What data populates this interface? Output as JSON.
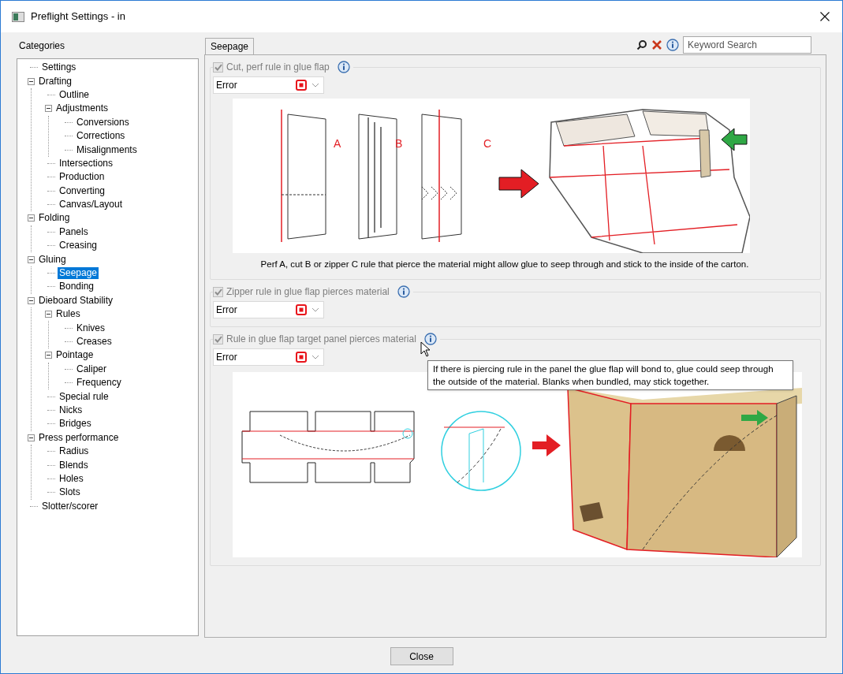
{
  "window": {
    "title": "Preflight Settings - in"
  },
  "categories": {
    "title": "Categories",
    "tree": [
      {
        "label": "Settings",
        "selected": false
      },
      {
        "label": "Drafting",
        "selected": false,
        "expanded": true,
        "children": [
          {
            "label": "Outline",
            "selected": false
          },
          {
            "label": "Adjustments",
            "selected": false,
            "expanded": true,
            "children": [
              {
                "label": "Conversions",
                "selected": false
              },
              {
                "label": "Corrections",
                "selected": false
              },
              {
                "label": "Misalignments",
                "selected": false
              }
            ]
          },
          {
            "label": "Intersections",
            "selected": false
          },
          {
            "label": "Production",
            "selected": false
          },
          {
            "label": "Converting",
            "selected": false
          },
          {
            "label": "Canvas/Layout",
            "selected": false
          }
        ]
      },
      {
        "label": "Folding",
        "selected": false,
        "expanded": true,
        "children": [
          {
            "label": "Panels",
            "selected": false
          },
          {
            "label": "Creasing",
            "selected": false
          }
        ]
      },
      {
        "label": "Gluing",
        "selected": false,
        "expanded": true,
        "children": [
          {
            "label": "Seepage",
            "selected": true
          },
          {
            "label": "Bonding",
            "selected": false
          }
        ]
      },
      {
        "label": "Dieboard Stability",
        "selected": false,
        "expanded": true,
        "children": [
          {
            "label": "Rules",
            "selected": false,
            "expanded": true,
            "children": [
              {
                "label": "Knives",
                "selected": false
              },
              {
                "label": "Creases",
                "selected": false
              }
            ]
          },
          {
            "label": "Pointage",
            "selected": false,
            "expanded": true,
            "children": [
              {
                "label": "Caliper",
                "selected": false
              },
              {
                "label": "Frequency",
                "selected": false
              }
            ]
          },
          {
            "label": "Special rule",
            "selected": false
          },
          {
            "label": "Nicks",
            "selected": false
          },
          {
            "label": "Bridges",
            "selected": false
          }
        ]
      },
      {
        "label": "Press performance",
        "selected": false,
        "expanded": true,
        "children": [
          {
            "label": "Radius",
            "selected": false
          },
          {
            "label": "Blends",
            "selected": false
          },
          {
            "label": "Holes",
            "selected": false
          },
          {
            "label": "Slots",
            "selected": false
          }
        ]
      },
      {
        "label": "Slotter/scorer",
        "selected": false
      }
    ]
  },
  "tabs": [
    {
      "label": "Seepage",
      "selected": true
    }
  ],
  "search": {
    "placeholder": "Keyword Search"
  },
  "checks": [
    {
      "label": "Cut, perf rule in glue flap",
      "checked": true,
      "disabled": true,
      "severity": "Error",
      "figure": {
        "kind": "rules",
        "labels": [
          "A",
          "B",
          "C"
        ],
        "caption": "Perf A, cut B or zipper C rule that pierce the material might allow glue to seep through and stick to the inside of the carton."
      }
    },
    {
      "label": "Zipper rule in glue flap pierces material",
      "checked": true,
      "disabled": true,
      "severity": "Error"
    },
    {
      "label": "Rule in glue flap target panel pierces material",
      "checked": true,
      "disabled": true,
      "severity": "Error",
      "figure": {
        "kind": "box"
      },
      "tooltip": "If there is piercing rule in the panel the glue flap will bond to, glue could seep through the outside of the material.  Blanks when bundled, may stick together."
    }
  ],
  "buttons": [
    "Close"
  ]
}
